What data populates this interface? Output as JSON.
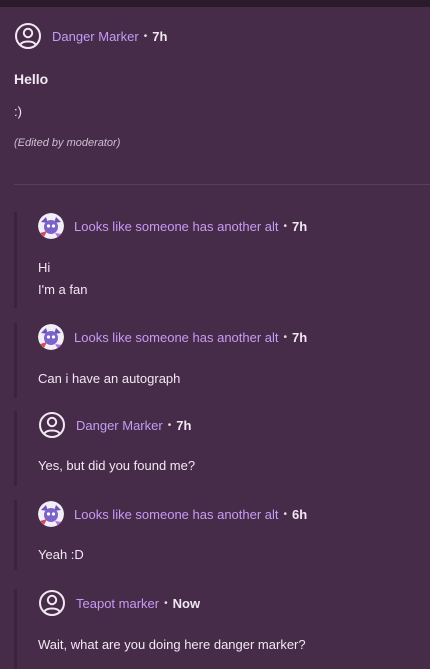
{
  "post": {
    "author": "Danger Marker",
    "time": "7h",
    "title": "Hello",
    "body": ":)",
    "edited_note": "(Edited by moderator)"
  },
  "comments": [
    {
      "author": "Looks like someone has another alt",
      "time": "7h",
      "lines": [
        "Hi",
        "I'm a fan"
      ],
      "avatar": "character-avatar"
    },
    {
      "author": "Looks like someone has another alt",
      "time": "7h",
      "lines": [
        "Can i have an autograph"
      ],
      "avatar": "character-avatar"
    },
    {
      "author": "Danger Marker",
      "time": "7h",
      "lines": [
        "Yes, but did you found me?"
      ],
      "avatar": "user-icon"
    },
    {
      "author": "Looks like someone has another alt",
      "time": "6h",
      "lines": [
        "Yeah :D"
      ],
      "avatar": "character-avatar"
    },
    {
      "author": "Teapot marker",
      "time": "Now",
      "lines": [
        "Wait, what are you doing here danger marker?"
      ],
      "avatar": "user-icon"
    }
  ],
  "separator": "•",
  "colors": {
    "background": "#472c4a",
    "accent": "#c79bf3",
    "thread_line": "#3a233c"
  }
}
